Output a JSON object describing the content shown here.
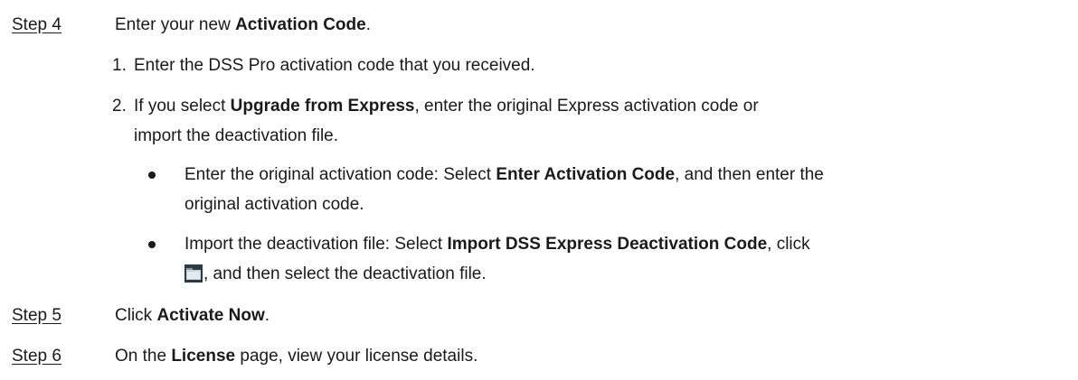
{
  "steps": [
    {
      "label": "Step 4",
      "pre": "Enter your new ",
      "bold": "Activation Code",
      "post": "."
    },
    {
      "label": "Step 5",
      "pre": "Click ",
      "bold": "Activate Now",
      "post": "."
    },
    {
      "label": "Step 6",
      "pre": "On the ",
      "bold": "License",
      "post": " page, view your license details."
    }
  ],
  "substeps": [
    {
      "num": "1.",
      "text": "Enter the DSS Pro activation code that you received."
    },
    {
      "num": "2.",
      "pre": "If you select ",
      "bold": "Upgrade from Express",
      "post": ", enter the original Express activation code or",
      "cont": "import the deactivation file."
    }
  ],
  "bullets": [
    {
      "pre": "Enter the original activation code: Select ",
      "bold": "Enter Activation Code",
      "post": ", and then enter the",
      "cont": "original activation code."
    },
    {
      "pre": "Import the deactivation file: Select ",
      "bold": "Import DSS Express Deactivation Code",
      "post": ", click",
      "cont_post": ", and then select the deactivation file.",
      "icon": "folder-icon"
    }
  ]
}
